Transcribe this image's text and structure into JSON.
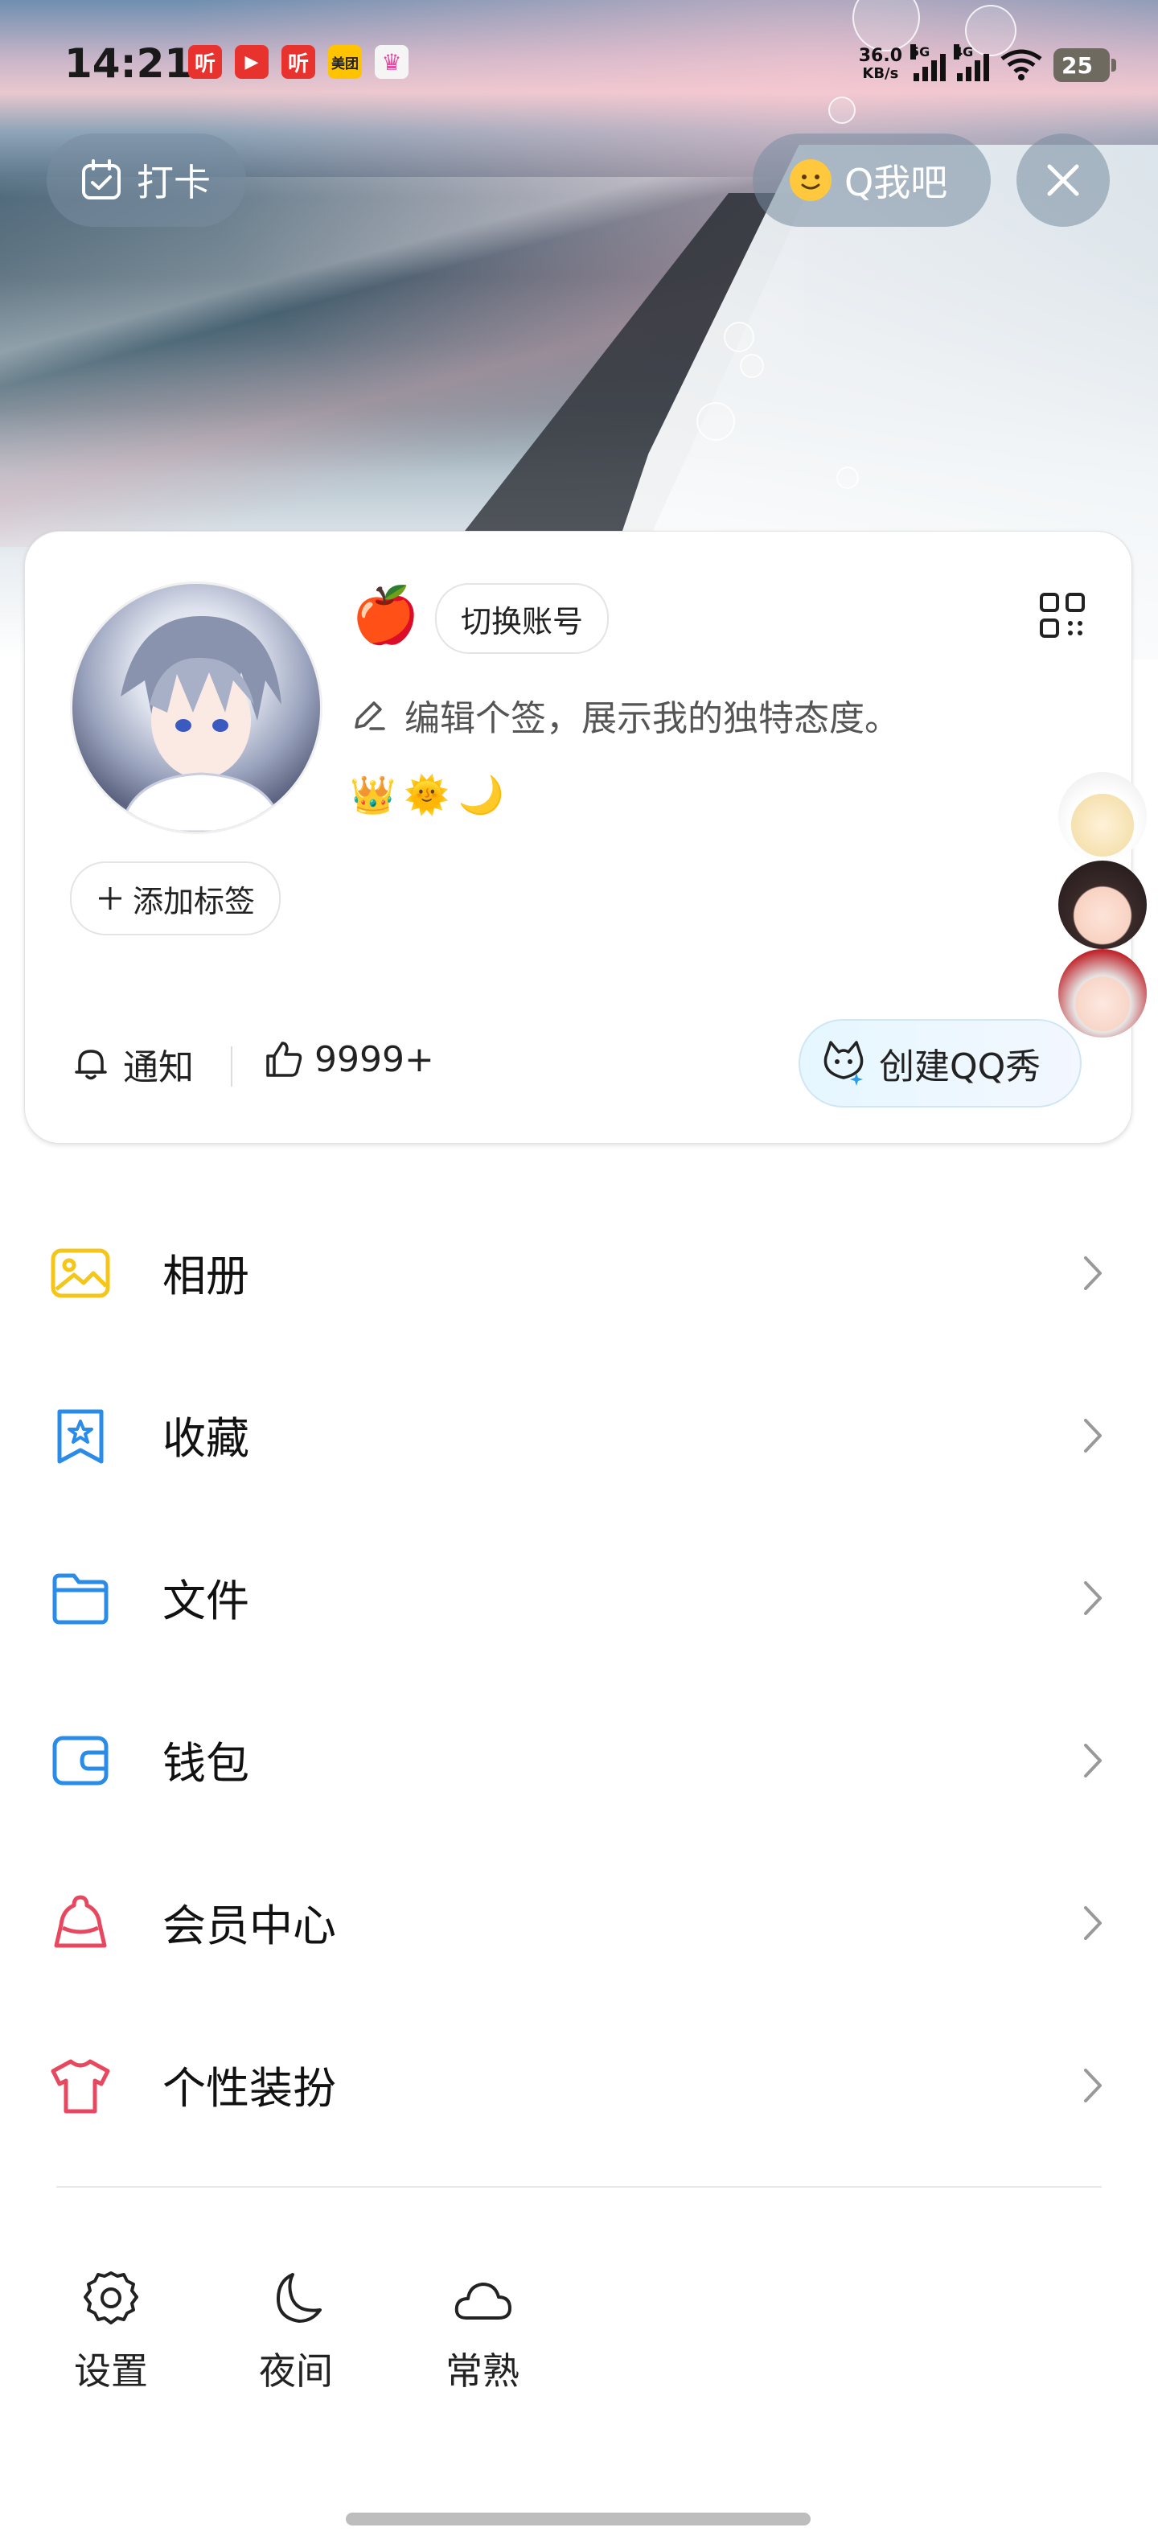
{
  "status_bar": {
    "time": "14:21",
    "apps": [
      {
        "name": "ting-icon",
        "text": "听",
        "color": "#e8322e"
      },
      {
        "name": "video-icon",
        "text": "▶",
        "color": "#e8322e"
      },
      {
        "name": "ting-icon-2",
        "text": "听",
        "color": "#e8322e"
      },
      {
        "name": "meituan-icon",
        "text": "美团",
        "color": "#ffc300"
      },
      {
        "name": "crown-app-icon",
        "text": "♛",
        "color": "#f5f5f5"
      }
    ],
    "net_speed_value": "36.0",
    "net_speed_unit": "KB/s",
    "sim1": "5G",
    "sim2": "4G",
    "battery": "25"
  },
  "header": {
    "checkin_label": "打卡",
    "qbar_label": "Q我吧"
  },
  "profile": {
    "switch_account": "切换账号",
    "signature": "编辑个签，展示我的独特态度。",
    "badges": [
      "👑",
      "🌞",
      "🌙"
    ],
    "add_tag": "添加标签",
    "notify": "通知",
    "likes": "9999+",
    "create_qqshow": "创建QQ秀"
  },
  "menu": {
    "items": [
      {
        "label": "相册",
        "icon": "album-icon",
        "color": "#f5c518"
      },
      {
        "label": "收藏",
        "icon": "favorite-icon",
        "color": "#2a8ce8"
      },
      {
        "label": "文件",
        "icon": "folder-icon",
        "color": "#2a8ce8"
      },
      {
        "label": "钱包",
        "icon": "wallet-icon",
        "color": "#2a8ce8"
      },
      {
        "label": "会员中心",
        "icon": "vip-icon",
        "color": "#e8485f"
      },
      {
        "label": "个性装扮",
        "icon": "tshirt-icon",
        "color": "#e8485f"
      }
    ]
  },
  "bottom_bar": {
    "settings": "设置",
    "night": "夜间",
    "weather": "常熟"
  }
}
